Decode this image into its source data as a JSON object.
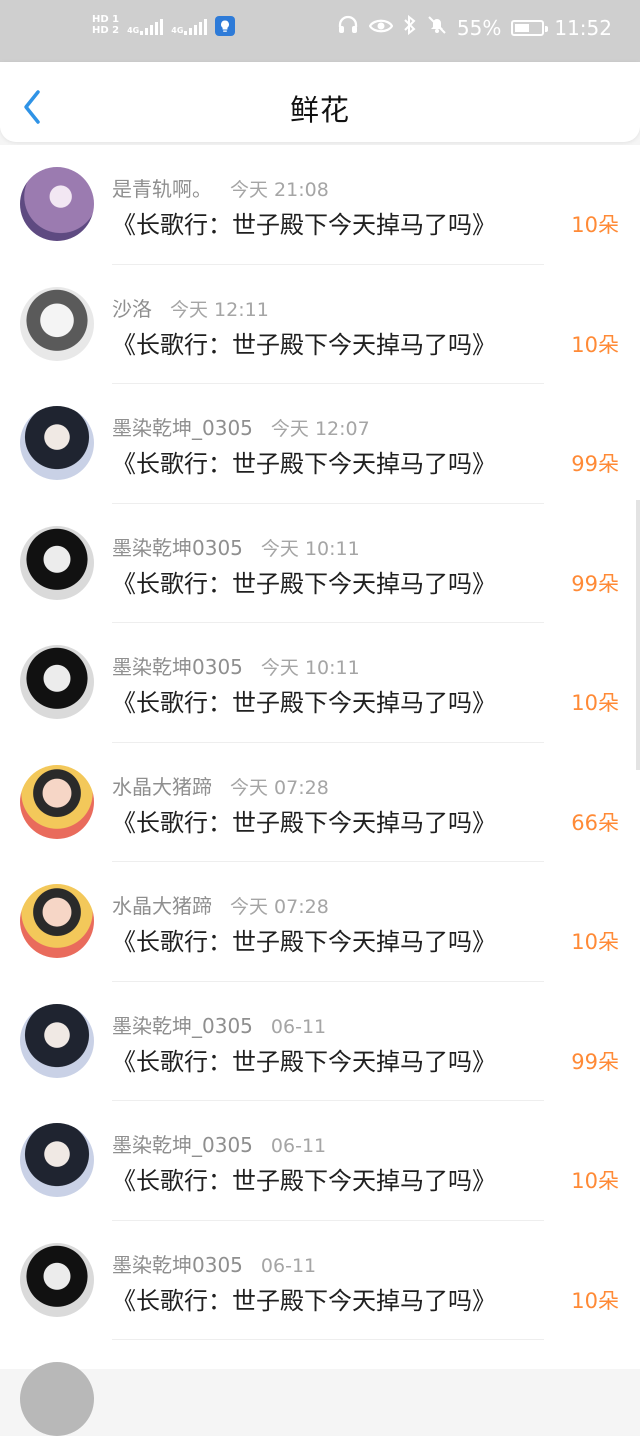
{
  "status_bar": {
    "hd1": "HD 1",
    "hd2": "HD 2",
    "net1": "4G",
    "net2": "4G",
    "battery_percent": "55%",
    "battery_fill": 0.55,
    "time": "11:52",
    "icons": [
      "headphones-icon",
      "eye-icon",
      "bluetooth-icon",
      "bell-mute-icon",
      "battery-icon",
      "bulb-icon"
    ]
  },
  "header": {
    "title": "鲜花",
    "accent_color": "#2f93e6"
  },
  "flowers": {
    "accent": "#ff8a36",
    "rows": [
      {
        "user": "是青轨啊。",
        "time": "今天 21:08",
        "book": "《长歌行：世子殿下今天掉马了吗》",
        "count": "10朵",
        "avatar": "purple"
      },
      {
        "user": "沙洛",
        "time": "今天 12:11",
        "book": "《长歌行：世子殿下今天掉马了吗》",
        "count": "10朵",
        "avatar": "anime"
      },
      {
        "user": "墨染乾坤_0305",
        "time": "今天 12:07",
        "book": "《长歌行：世子殿下今天掉马了吗》",
        "count": "99朵",
        "avatar": "blue"
      },
      {
        "user": "墨染乾坤0305",
        "time": "今天 10:11",
        "book": "《长歌行：世子殿下今天掉马了吗》",
        "count": "99朵",
        "avatar": "dark"
      },
      {
        "user": "墨染乾坤0305",
        "time": "今天 10:11",
        "book": "《长歌行：世子殿下今天掉马了吗》",
        "count": "10朵",
        "avatar": "dark"
      },
      {
        "user": "水晶大猪蹄",
        "time": "今天 07:28",
        "book": "《长歌行：世子殿下今天掉马了吗》",
        "count": "66朵",
        "avatar": "warm"
      },
      {
        "user": "水晶大猪蹄",
        "time": "今天 07:28",
        "book": "《长歌行：世子殿下今天掉马了吗》",
        "count": "10朵",
        "avatar": "warm"
      },
      {
        "user": "墨染乾坤_0305",
        "time": "06-11",
        "book": "《长歌行：世子殿下今天掉马了吗》",
        "count": "99朵",
        "avatar": "blue"
      },
      {
        "user": "墨染乾坤_0305",
        "time": "06-11",
        "book": "《长歌行：世子殿下今天掉马了吗》",
        "count": "10朵",
        "avatar": "blue"
      },
      {
        "user": "墨染乾坤0305",
        "time": "06-11",
        "book": "《长歌行：世子殿下今天掉马了吗》",
        "count": "10朵",
        "avatar": "dark"
      }
    ]
  }
}
